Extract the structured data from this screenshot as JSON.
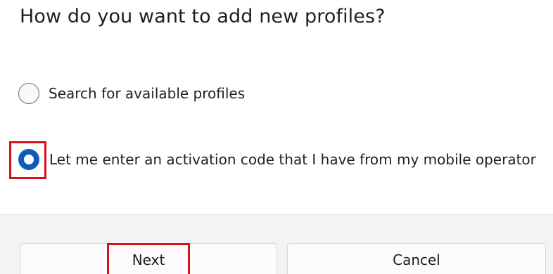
{
  "dialog": {
    "title": "How do you want to add new profiles?"
  },
  "options": [
    {
      "label": "Search for available profiles",
      "selected": false
    },
    {
      "label": "Let me enter an activation code that I have from my mobile operator",
      "selected": true
    }
  ],
  "buttons": {
    "next_label": "Next",
    "cancel_label": "Cancel"
  },
  "colors": {
    "accent": "#0f5cb8",
    "highlight": "#d2141a",
    "footer_bg": "#f3f3f3"
  }
}
